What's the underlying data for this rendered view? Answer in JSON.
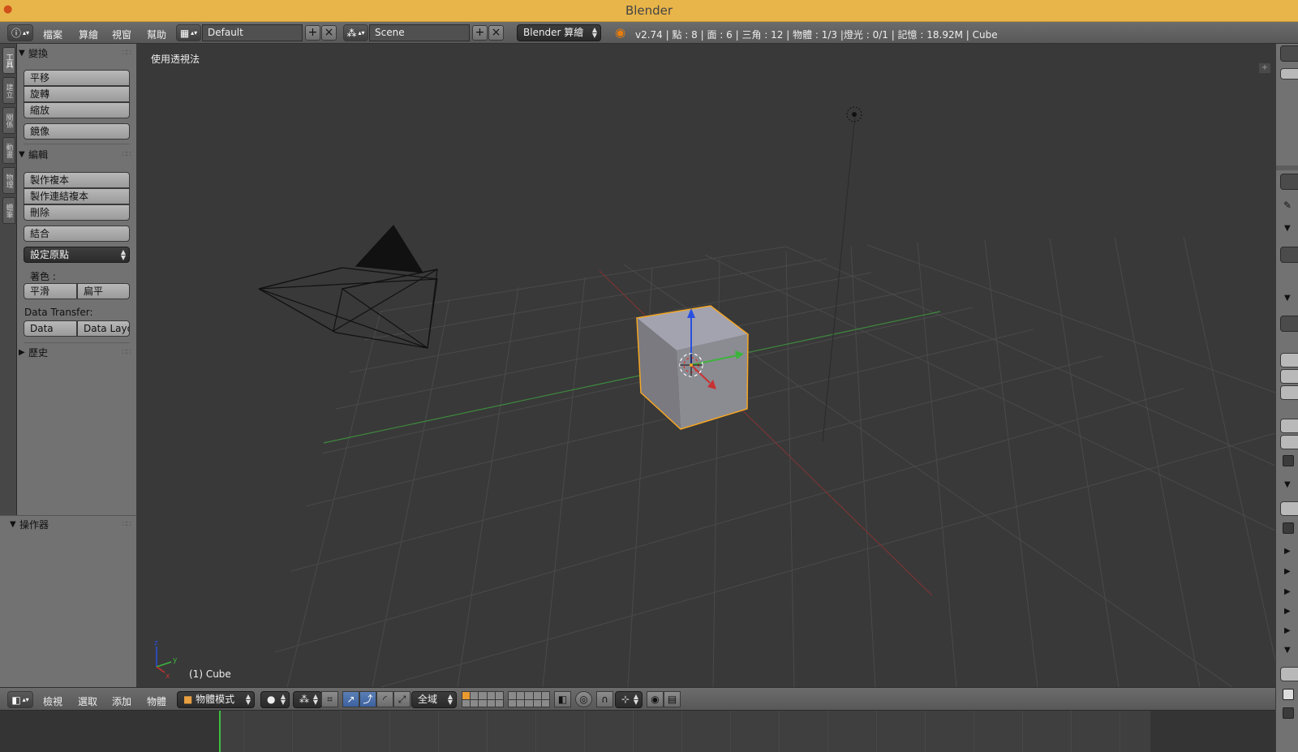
{
  "window": {
    "title": "Blender"
  },
  "top_header": {
    "menus": [
      "檔案",
      "算繪",
      "視窗",
      "幫助"
    ],
    "layout_name": "Default",
    "scene_name": "Scene",
    "render_engine": "Blender 算繪",
    "stats": "v2.74 | 點 : 8 | 面 : 6 | 三角 : 12 | 物體 : 1/3 |燈光 : 0/1 | 記憶 : 18.92M | Cube"
  },
  "tool_tabs": [
    "工具",
    "建立",
    "關係",
    "動畫",
    "物理",
    "蠟筆"
  ],
  "tool_shelf": {
    "transform": {
      "title": "變換",
      "buttons": [
        "平移",
        "旋轉",
        "縮放",
        "鏡像"
      ]
    },
    "edit": {
      "title": "編輯",
      "buttons": [
        "製作複本",
        "製作連結複本",
        "刪除",
        "結合"
      ],
      "set_origin": "設定原點",
      "shading_label": "著色 :",
      "shading_buttons": [
        "平滑",
        "扁平"
      ],
      "data_transfer_label": "Data Transfer:",
      "data_transfer_buttons": [
        "Data",
        "Data Layo"
      ]
    },
    "history": {
      "title": "歷史"
    }
  },
  "operator_panel": {
    "title": "操作器"
  },
  "viewport": {
    "view_label": "使用透視法",
    "object_label": "(1) Cube",
    "axis_labels": {
      "x": "x",
      "y": "y",
      "z": "z"
    }
  },
  "bottom_header": {
    "menus": [
      "檢視",
      "選取",
      "添加",
      "物體"
    ],
    "mode": "物體模式",
    "pivot_scope": "全域"
  },
  "colors": {
    "title_bar": "#e8b54a",
    "panel_bg": "#727272",
    "viewport_bg": "#393939",
    "selection_outline": "#f5a623",
    "x_axis": "#c83232",
    "y_axis": "#3cb43c",
    "z_axis": "#2850e0",
    "active_tool": "#4a6fb0"
  },
  "icons": [
    "blender-icon",
    "info-icon",
    "layout-grid-icon",
    "add-icon",
    "close-icon",
    "scene-icon",
    "blender-logo-icon",
    "cube-icon",
    "sphere-icon",
    "manipulator-icon",
    "translate-icon",
    "rotate-icon",
    "scale-icon",
    "layers-icon",
    "lock-icon",
    "proportional-icon",
    "snap-magnet-icon",
    "render-icon"
  ]
}
